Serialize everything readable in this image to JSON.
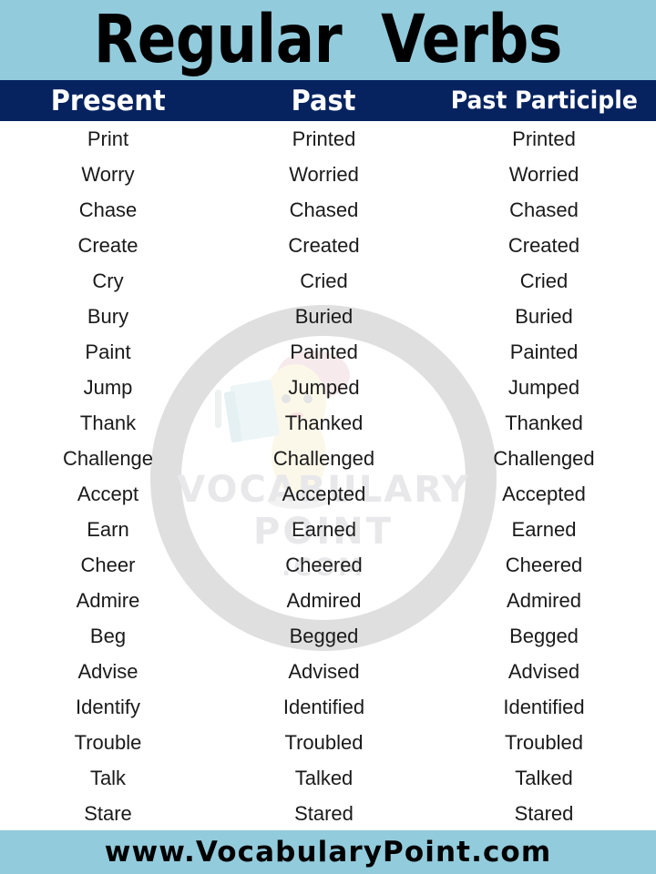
{
  "header": {
    "title": "Regular  Verbs",
    "banner_color": "#92cbdc",
    "title_color": "#000000"
  },
  "table": {
    "header_bar_color": "#062360",
    "header_text_color": "#ffffff",
    "columns": [
      "Present",
      "Past",
      "Past Participle"
    ],
    "rows": [
      [
        "Print",
        "Printed",
        "Printed"
      ],
      [
        "Worry",
        "Worried",
        "Worried"
      ],
      [
        "Chase",
        "Chased",
        "Chased"
      ],
      [
        "Create",
        "Created",
        "Created"
      ],
      [
        "Cry",
        "Cried",
        "Cried"
      ],
      [
        "Bury",
        "Buried",
        "Buried"
      ],
      [
        "Paint",
        "Painted",
        "Painted"
      ],
      [
        "Jump",
        "Jumped",
        "Jumped"
      ],
      [
        "Thank",
        "Thanked",
        "Thanked"
      ],
      [
        "Challenge",
        "Challenged",
        "Challenged"
      ],
      [
        "Accept",
        "Accepted",
        "Accepted"
      ],
      [
        "Earn",
        "Earned",
        "Earned"
      ],
      [
        "Cheer",
        "Cheered",
        "Cheered"
      ],
      [
        "Admire",
        "Admired",
        "Admired"
      ],
      [
        "Beg",
        "Begged",
        "Begged"
      ],
      [
        "Advise",
        "Advised",
        "Advised"
      ],
      [
        "Identify",
        "Identified",
        "Identified"
      ],
      [
        "Trouble",
        "Troubled",
        "Troubled"
      ],
      [
        "Talk",
        "Talked",
        "Talked"
      ],
      [
        "Stare",
        "Stared",
        "Stared"
      ]
    ]
  },
  "watermark": {
    "line1": "VOCABULARY",
    "line2": "POINT",
    "line3": ".COM",
    "ring_color": "#dcdcdc",
    "text_color": "#e8e8ea"
  },
  "footer": {
    "url": "www.VocabularyPoint.com",
    "banner_color": "#92cbdc",
    "text_color": "#000000"
  }
}
